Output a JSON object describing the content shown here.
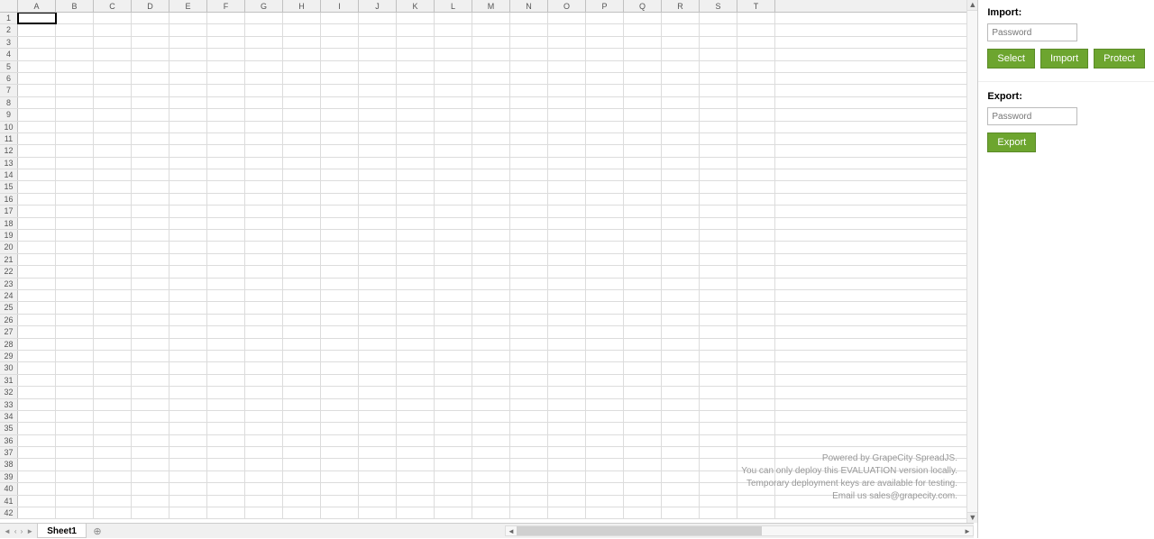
{
  "sheet": {
    "columns": [
      "A",
      "B",
      "C",
      "D",
      "E",
      "F",
      "G",
      "H",
      "I",
      "J",
      "K",
      "L",
      "M",
      "N",
      "O",
      "P",
      "Q",
      "R",
      "S",
      "T"
    ],
    "rowsVisible": 42,
    "selectedCell": {
      "row": 0,
      "col": 0
    },
    "tabs": [
      "Sheet1"
    ],
    "activeTab": 0
  },
  "watermark": {
    "line1": "Powered by GrapeCity SpreadJS.",
    "line2": "You can only deploy this EVALUATION version locally.",
    "line3": "Temporary deployment keys are available for testing.",
    "line4": "Email us sales@grapecity.com."
  },
  "sidebar": {
    "import": {
      "label": "Import:",
      "placeholder": "Password",
      "buttons": {
        "select": "Select",
        "import": "Import",
        "protect": "Protect"
      }
    },
    "export": {
      "label": "Export:",
      "placeholder": "Password",
      "buttons": {
        "export": "Export"
      }
    }
  }
}
